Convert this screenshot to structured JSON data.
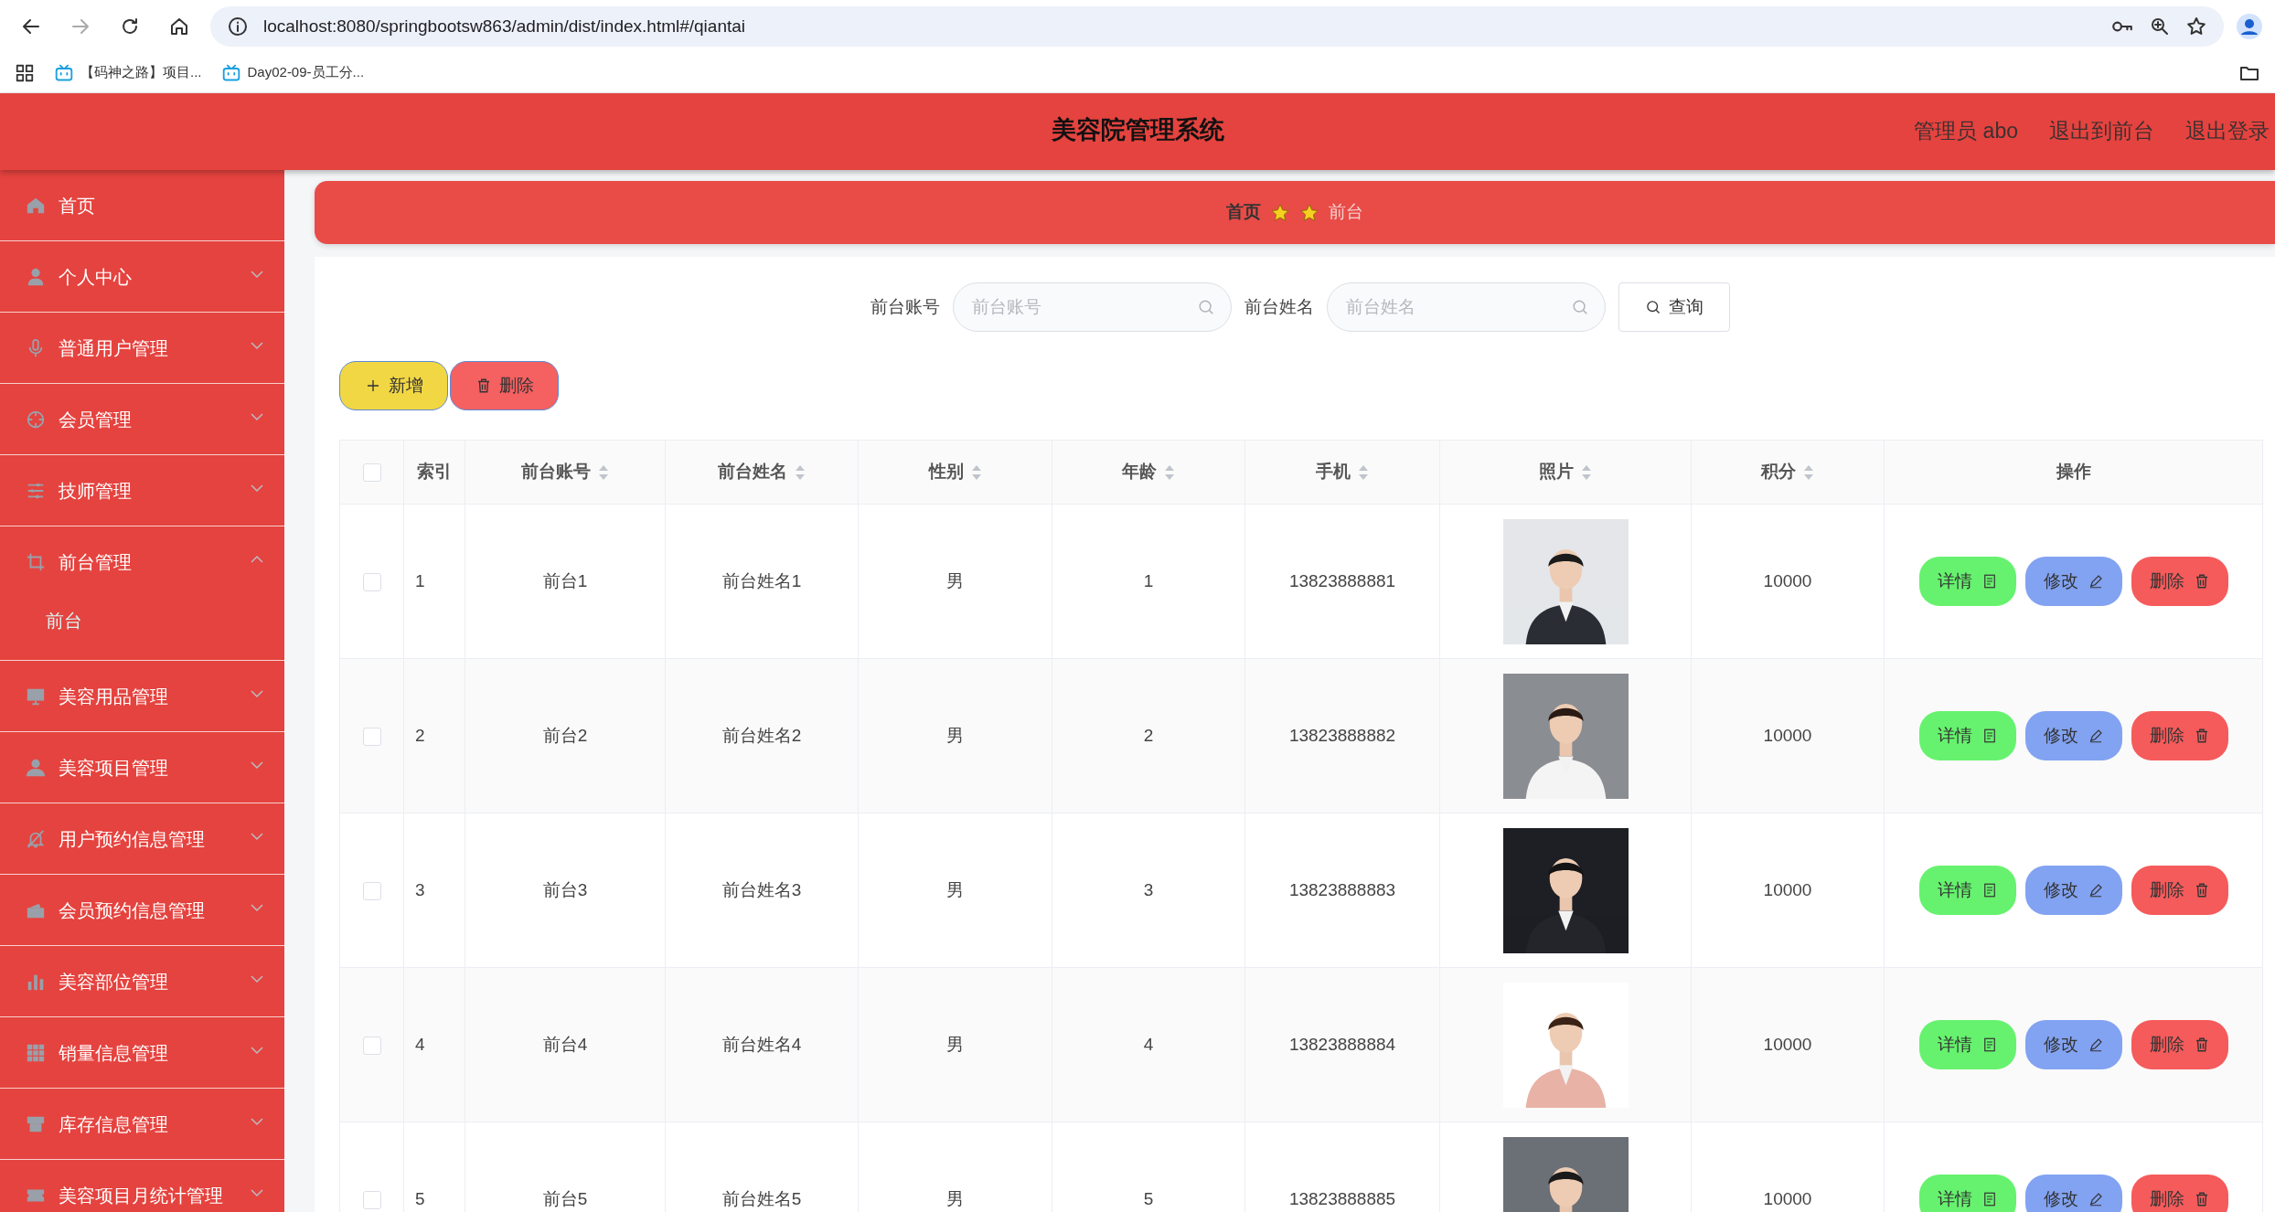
{
  "browser": {
    "url": "localhost:8080/springbootsw863/admin/dist/index.html#/qiantai",
    "bookmarks": [
      "【码神之路】项目...",
      "Day02-09-员工分..."
    ]
  },
  "header": {
    "title": "美容院管理系统",
    "links": [
      "管理员 abo",
      "退出到前台",
      "退出登录"
    ]
  },
  "sidebar": {
    "items": [
      {
        "label": "首页",
        "kind": "link"
      },
      {
        "label": "个人中心",
        "kind": "menu",
        "expanded": false
      },
      {
        "label": "普通用户管理",
        "kind": "menu",
        "expanded": false
      },
      {
        "label": "会员管理",
        "kind": "menu",
        "expanded": false
      },
      {
        "label": "技师管理",
        "kind": "menu",
        "expanded": false
      },
      {
        "label": "前台管理",
        "kind": "menu",
        "expanded": true,
        "children": [
          {
            "label": "前台",
            "selected": true
          }
        ]
      },
      {
        "label": "美容用品管理",
        "kind": "menu",
        "expanded": false
      },
      {
        "label": "美容项目管理",
        "kind": "menu",
        "expanded": false
      },
      {
        "label": "用户预约信息管理",
        "kind": "menu",
        "expanded": false
      },
      {
        "label": "会员预约信息管理",
        "kind": "menu",
        "expanded": false
      },
      {
        "label": "美容部位管理",
        "kind": "menu",
        "expanded": false
      },
      {
        "label": "销量信息管理",
        "kind": "menu",
        "expanded": false
      },
      {
        "label": "库存信息管理",
        "kind": "menu",
        "expanded": false
      },
      {
        "label": "美容项目月统计管理",
        "kind": "menu",
        "expanded": false
      }
    ]
  },
  "breadcrumb": [
    "首页",
    "前台"
  ],
  "search": {
    "fields": [
      {
        "label": "前台账号",
        "placeholder": "前台账号"
      },
      {
        "label": "前台姓名",
        "placeholder": "前台姓名"
      }
    ],
    "button": "查询"
  },
  "actions": [
    {
      "label": "新增",
      "kind": "add"
    },
    {
      "label": "删除",
      "kind": "delete"
    }
  ],
  "table": {
    "select_all": {
      "checked": false
    },
    "columns": [
      {
        "label": "索引",
        "sortable": false
      },
      {
        "label": "前台账号",
        "sortable": true
      },
      {
        "label": "前台姓名",
        "sortable": true
      },
      {
        "label": "性别",
        "sortable": true
      },
      {
        "label": "年龄",
        "sortable": true
      },
      {
        "label": "手机",
        "sortable": true
      },
      {
        "label": "照片",
        "sortable": true
      },
      {
        "label": "积分",
        "sortable": true
      },
      {
        "label": "操作",
        "sortable": false
      }
    ],
    "rows": [
      {
        "selected": false,
        "cells": [
          "1",
          "前台1",
          "前台姓名1",
          "男",
          "1",
          "13823888881"
        ],
        "points": "10000",
        "actions": [
          {
            "label": "详情",
            "kind": "detail"
          },
          {
            "label": "修改",
            "kind": "edit"
          },
          {
            "label": "删除",
            "kind": "delete"
          }
        ]
      },
      {
        "selected": false,
        "cells": [
          "2",
          "前台2",
          "前台姓名2",
          "男",
          "2",
          "13823888882"
        ],
        "points": "10000",
        "actions": [
          {
            "label": "详情",
            "kind": "detail"
          },
          {
            "label": "修改",
            "kind": "edit"
          },
          {
            "label": "删除",
            "kind": "delete"
          }
        ]
      },
      {
        "selected": false,
        "cells": [
          "3",
          "前台3",
          "前台姓名3",
          "男",
          "3",
          "13823888883"
        ],
        "points": "10000",
        "actions": [
          {
            "label": "详情",
            "kind": "detail"
          },
          {
            "label": "修改",
            "kind": "edit"
          },
          {
            "label": "删除",
            "kind": "delete"
          }
        ]
      },
      {
        "selected": false,
        "cells": [
          "4",
          "前台4",
          "前台姓名4",
          "男",
          "4",
          "13823888884"
        ],
        "points": "10000",
        "actions": [
          {
            "label": "详情",
            "kind": "detail"
          },
          {
            "label": "修改",
            "kind": "edit"
          },
          {
            "label": "删除",
            "kind": "delete"
          }
        ]
      },
      {
        "selected": false,
        "cells": [
          "5",
          "前台5",
          "前台姓名5",
          "男",
          "5",
          "13823888885"
        ],
        "points": "10000",
        "actions": [
          {
            "label": "详情",
            "kind": "detail"
          },
          {
            "label": "修改",
            "kind": "edit"
          },
          {
            "label": "删除",
            "kind": "delete"
          }
        ]
      }
    ]
  }
}
